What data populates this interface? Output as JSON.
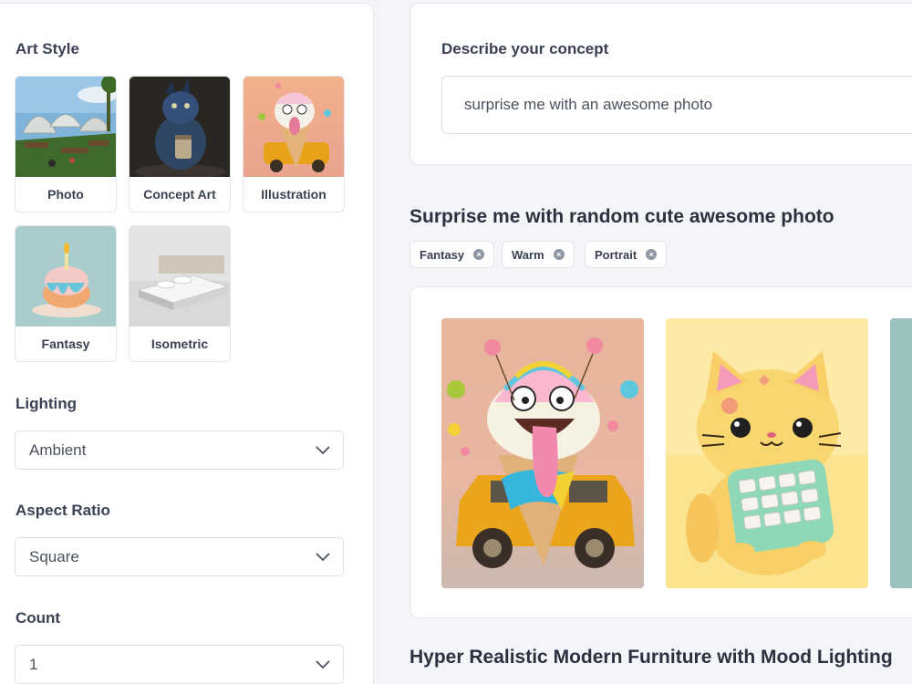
{
  "sidebar": {
    "art_style": {
      "title": "Art Style",
      "cards": [
        {
          "label": "Photo",
          "icon": "photo-thumbnail"
        },
        {
          "label": "Concept Art",
          "icon": "concept-art-thumbnail"
        },
        {
          "label": "Illustration",
          "icon": "illustration-thumbnail"
        },
        {
          "label": "Fantasy",
          "icon": "fantasy-thumbnail"
        },
        {
          "label": "Isometric",
          "icon": "isometric-thumbnail"
        }
      ]
    },
    "lighting": {
      "title": "Lighting",
      "value": "Ambient"
    },
    "aspect_ratio": {
      "title": "Aspect Ratio",
      "value": "Square"
    },
    "count": {
      "title": "Count",
      "value": "1"
    }
  },
  "concept": {
    "label": "Describe your concept",
    "value": "surprise me with an awesome photo"
  },
  "galleries": [
    {
      "title": "Surprise me with random cute awesome photo",
      "tags": [
        "Fantasy",
        "Warm",
        "Portrait"
      ],
      "images": [
        "ice-cream-character-on-car",
        "cat-with-calculator",
        "partial-image"
      ]
    },
    {
      "title": "Hyper Realistic Modern Furniture with Mood Lighting"
    }
  ],
  "colors": {
    "accent_text": "#2c3140",
    "border": "#e3e6ec",
    "background": "#f4f5f8"
  }
}
